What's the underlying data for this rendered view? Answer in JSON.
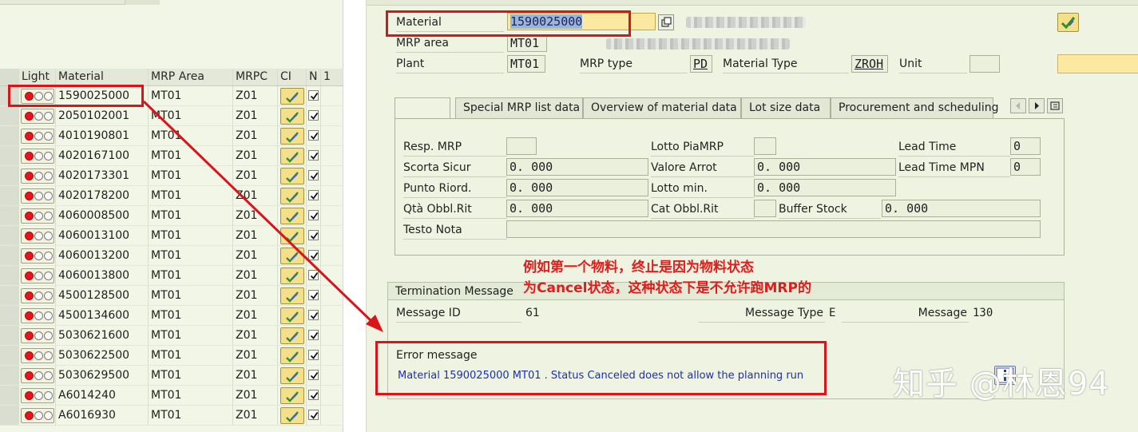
{
  "left_list": {
    "columns": [
      "Light",
      "Material",
      "MRP Area",
      "MRPC",
      "CI",
      "N",
      "1"
    ],
    "rows": [
      {
        "material": "1590025000",
        "mrp_area": "MT01",
        "mrpc": "Z01"
      },
      {
        "material": "2050102001",
        "mrp_area": "MT01",
        "mrpc": "Z01"
      },
      {
        "material": "4010190801",
        "mrp_area": "MT01",
        "mrpc": "Z01"
      },
      {
        "material": "4020167100",
        "mrp_area": "MT01",
        "mrpc": "Z01"
      },
      {
        "material": "4020173301",
        "mrp_area": "MT01",
        "mrpc": "Z01"
      },
      {
        "material": "4020178200",
        "mrp_area": "MT01",
        "mrpc": "Z01"
      },
      {
        "material": "4060008500",
        "mrp_area": "MT01",
        "mrpc": "Z01"
      },
      {
        "material": "4060013100",
        "mrp_area": "MT01",
        "mrpc": "Z01"
      },
      {
        "material": "4060013200",
        "mrp_area": "MT01",
        "mrpc": "Z01"
      },
      {
        "material": "4060013800",
        "mrp_area": "MT01",
        "mrpc": "Z01"
      },
      {
        "material": "4500128500",
        "mrp_area": "MT01",
        "mrpc": "Z01"
      },
      {
        "material": "4500134600",
        "mrp_area": "MT01",
        "mrpc": "Z01"
      },
      {
        "material": "5030621600",
        "mrp_area": "MT01",
        "mrpc": "Z01"
      },
      {
        "material": "5030622500",
        "mrp_area": "MT01",
        "mrpc": "Z01"
      },
      {
        "material": "5030629500",
        "mrp_area": "MT01",
        "mrpc": "Z01"
      },
      {
        "material": "A6014240",
        "mrp_area": "MT01",
        "mrpc": "Z01"
      },
      {
        "material": "A6016930",
        "mrp_area": "MT01",
        "mrpc": "Z01"
      }
    ]
  },
  "header": {
    "material_label": "Material",
    "material_value": "1590025000",
    "mrp_area_label": "MRP area",
    "mrp_area_value": "MT01",
    "plant_label": "Plant",
    "plant_value": "MT01",
    "mrp_type_label": "MRP type",
    "mrp_type_value": "PD",
    "material_type_label": "Material Type",
    "material_type_value": "ZROH",
    "unit_label": "Unit",
    "unit_value": ""
  },
  "tabs": [
    {
      "label": ""
    },
    {
      "label": "Special MRP list data"
    },
    {
      "label": "Overview of material data"
    },
    {
      "label": "Lot size data"
    },
    {
      "label": "Procurement and scheduling"
    }
  ],
  "mrp_fields": {
    "resp_mrp": {
      "label": "Resp. MRP",
      "value": ""
    },
    "lotto_piamrp": {
      "label": "Lotto PiaMRP",
      "value": ""
    },
    "lead_time": {
      "label": "Lead Time",
      "value": "0"
    },
    "scorta_sicur": {
      "label": "Scorta Sicur",
      "value": "0. 000"
    },
    "valore_arrot": {
      "label": "Valore Arrot",
      "value": "0. 000"
    },
    "lead_time_mpn": {
      "label": "Lead Time MPN",
      "value": "0"
    },
    "punto_riord": {
      "label": "Punto Riord.",
      "value": "0. 000"
    },
    "lotto_min": {
      "label": "Lotto min.",
      "value": "0. 000"
    },
    "qta_obbl_rit": {
      "label": "Qtà Obbl.Rit",
      "value": "0. 000"
    },
    "cat_obbl_rit": {
      "label": "Cat Obbl.Rit",
      "value": ""
    },
    "buffer_stock": {
      "label": "Buffer Stock",
      "value": "0. 000"
    },
    "testo_nota": {
      "label": "Testo Nota",
      "value": ""
    }
  },
  "termination": {
    "title": "Termination Message",
    "message_id_label": "Message ID",
    "message_id_value": "61",
    "message_type_label": "Message Type",
    "message_type_value": "E",
    "message_label": "Message",
    "message_value": "130",
    "error_title": "Error message",
    "error_text": "Material 1590025000 MT01 . Status Canceled does not allow the planning run"
  },
  "annotation": {
    "line1": "例如第一个物料，终止是因为物料状态",
    "line2": "为Cancel状态，这种状态下是不允许跑MRP的"
  },
  "watermark": "知乎 @林恩94",
  "colors": {
    "annotation_red": "#e01d1d",
    "error_blue": "#1c2fb6",
    "panel_bg": "#eef4e1",
    "highlight_yellow": "#fbe9a1"
  }
}
